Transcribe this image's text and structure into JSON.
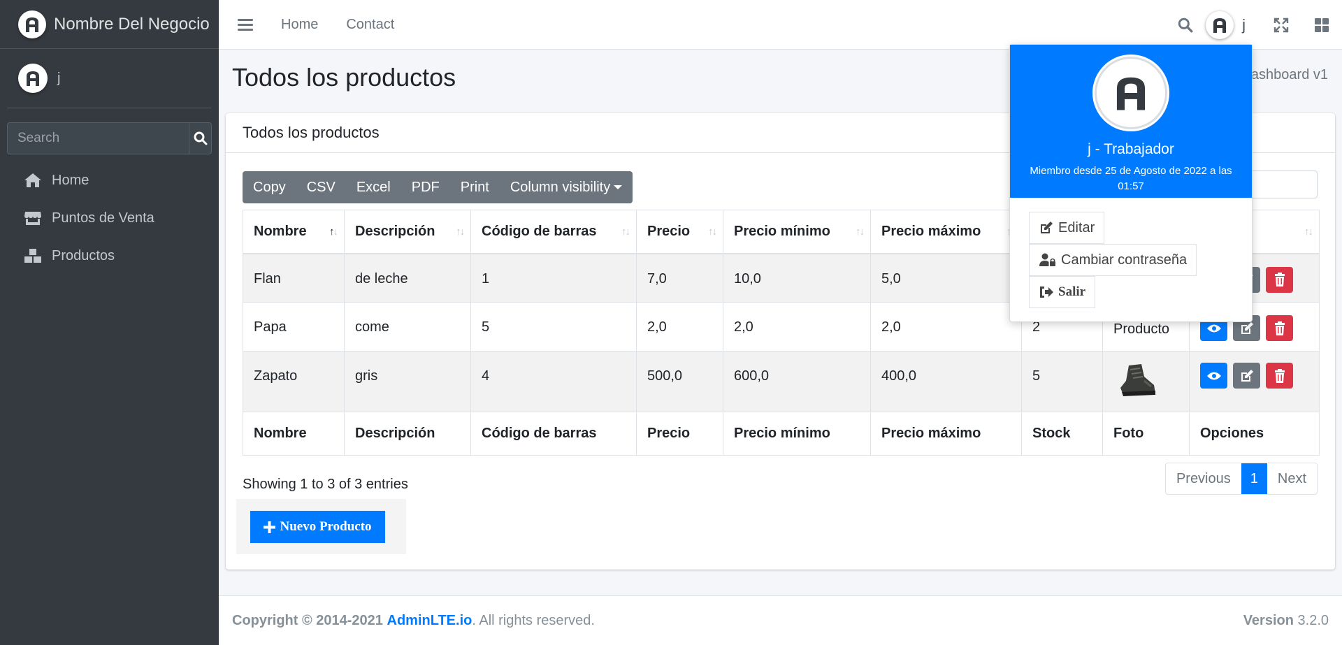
{
  "brand": {
    "name": "Nombre Del Negocio"
  },
  "user": {
    "name": "j"
  },
  "sidebar": {
    "search_placeholder": "Search",
    "items": [
      {
        "label": "Home",
        "icon": "home-icon"
      },
      {
        "label": "Puntos de Venta",
        "icon": "store-icon"
      },
      {
        "label": "Productos",
        "icon": "boxes-icon"
      }
    ]
  },
  "topbar": {
    "links": [
      "Home",
      "Contact"
    ],
    "user_name": "j"
  },
  "content": {
    "title": "Todos los productos",
    "breadcrumb": "ashboard v1"
  },
  "card": {
    "title": "Todos los productos",
    "buttons": [
      "Copy",
      "CSV",
      "Excel",
      "PDF",
      "Print",
      "Column visibility"
    ],
    "table": {
      "headers": [
        "Nombre",
        "Descripción",
        "Código de barras",
        "Precio",
        "Precio mínimo",
        "Precio máximo",
        "Stock",
        "Foto",
        "Opciones"
      ],
      "header_opciones_visible": "es",
      "rows": [
        [
          "Flan",
          "de leche",
          "1",
          "7,0",
          "10,0",
          "5,0",
          "",
          "",
          ""
        ],
        [
          "Papa",
          "come",
          "5",
          "2,0",
          "2,0",
          "2,0",
          "2",
          "Producto",
          ""
        ],
        [
          "Zapato",
          "gris",
          "4",
          "500,0",
          "600,0",
          "400,0",
          "5",
          "",
          ""
        ]
      ]
    },
    "info": "Showing 1 to 3 of 3 entries",
    "pagination": {
      "previous": "Previous",
      "current": "1",
      "next": "Next"
    },
    "new_button": "Nuevo Producto"
  },
  "footer": {
    "copyright": "Copyright © 2014-2021",
    "link": "AdminLTE.io",
    "rights": ". All rights reserved.",
    "version_label": "Version",
    "version": "3.2.0"
  },
  "dropdown": {
    "name": "j - Trabajador",
    "since": "Miembro desde 25 de Agosto de 2022 a las 01:57",
    "edit": "Editar",
    "change_password": "Cambiar contraseña",
    "logout": "Salir"
  },
  "colors": {
    "primary": "#007bff",
    "danger": "#dc3545",
    "secondary": "#6c757d",
    "sidebar": "#343a40"
  }
}
